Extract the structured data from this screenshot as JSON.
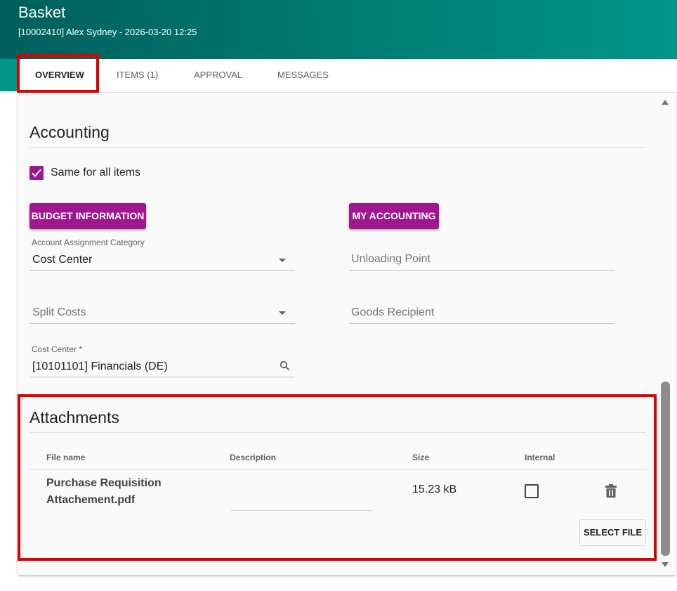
{
  "header": {
    "title": "Basket",
    "subtitle": "[10002410] Alex Sydney - 2026-03-20 12:25"
  },
  "tabs": [
    {
      "label": "OVERVIEW",
      "active": true
    },
    {
      "label": "ITEMS (1)",
      "active": false
    },
    {
      "label": "APPROVAL",
      "active": false
    },
    {
      "label": "MESSAGES",
      "active": false
    }
  ],
  "accounting": {
    "title": "Accounting",
    "same_for_all_label": "Same for all items",
    "same_for_all_checked": true,
    "budget_button": "BUDGET INFORMATION",
    "my_accounting_button": "MY ACCOUNTING",
    "assignment_label": "Account Assignment Category",
    "assignment_value": "Cost Center",
    "unloading_point_placeholder": "Unloading Point",
    "split_costs_placeholder": "Split Costs",
    "goods_recipient_placeholder": "Goods Recipient",
    "cost_center_label": "Cost Center *",
    "cost_center_value": "[10101101] Financials (DE)"
  },
  "attachments": {
    "title": "Attachments",
    "columns": [
      "File name",
      "Description",
      "Size",
      "Internal"
    ],
    "rows": [
      {
        "file_name": "Purchase Requisition Attachement.pdf",
        "description": "",
        "size": "15.23 kB",
        "internal": false
      }
    ],
    "select_file_button": "SELECT FILE"
  },
  "colors": {
    "accent": "#a0168f",
    "header_teal": "#00786e",
    "highlight_red": "#e00000"
  },
  "icons": [
    "check-icon",
    "dropdown-arrow-icon",
    "search-icon",
    "delete-icon",
    "scroll-up-icon",
    "scroll-down-icon"
  ]
}
